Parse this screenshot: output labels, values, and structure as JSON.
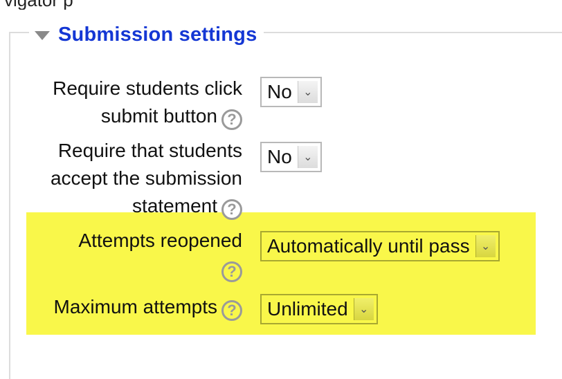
{
  "top_text": "vigator p",
  "section": {
    "title": "Submission settings",
    "collapse_icon": "triangle-down-icon"
  },
  "fields": {
    "require_submit": {
      "label_line1": "Require students click",
      "label_line2": "submit button",
      "value": "No"
    },
    "require_statement": {
      "label_line1": "Require that students",
      "label_line2": "accept the submission",
      "label_line3": "statement",
      "value": "No"
    },
    "attempts_reopened": {
      "label": "Attempts reopened",
      "value": "Automatically until pass"
    },
    "max_attempts": {
      "label": "Maximum attempts",
      "value": "Unlimited"
    }
  },
  "help_glyph": "?",
  "arrow_glyph": "⌄",
  "colors": {
    "highlight": "#f9f74a",
    "legend_title": "#1437d4",
    "help_icon": "#9a9a9a"
  }
}
